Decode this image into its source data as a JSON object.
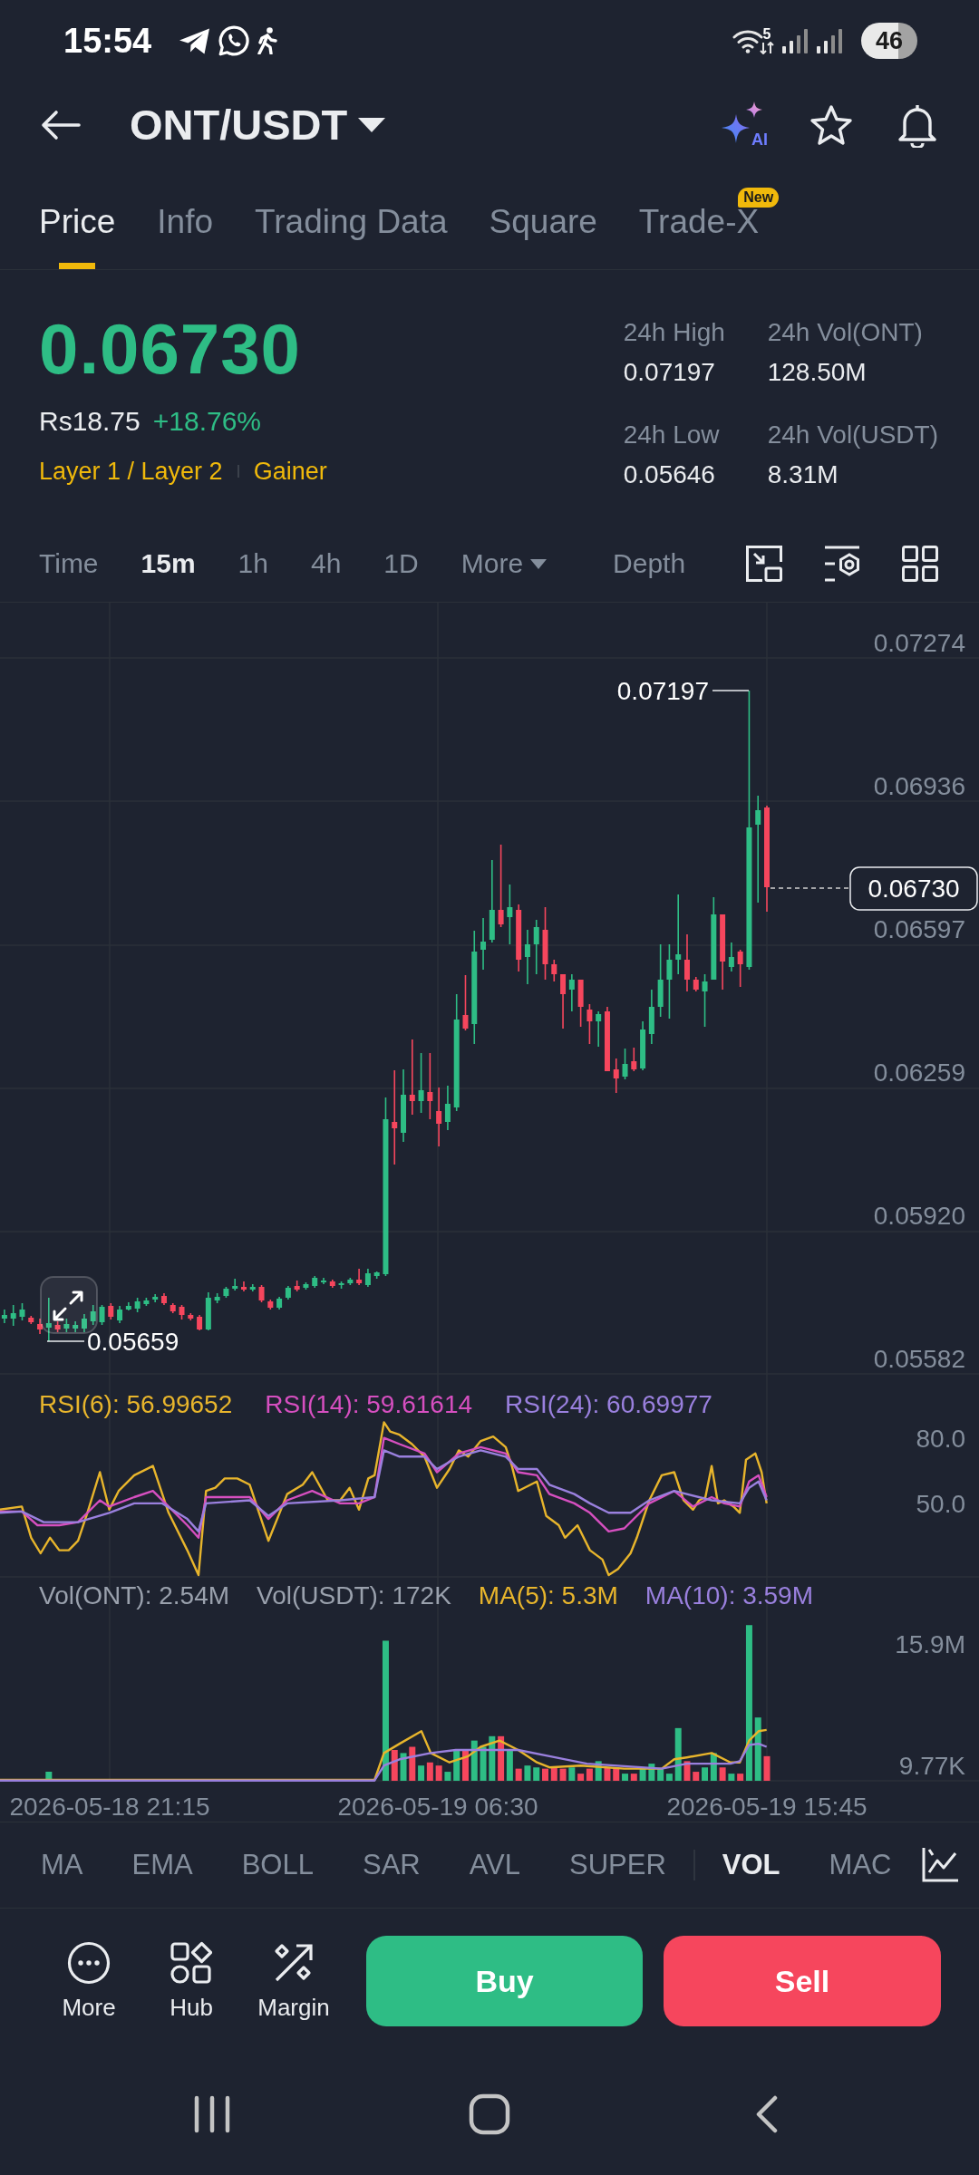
{
  "status_bar": {
    "time": "15:54",
    "network_type": "5",
    "battery": "46"
  },
  "header": {
    "title": "ONT/USDT",
    "ai_label": "AI"
  },
  "tabs": [
    {
      "label": "Price",
      "selected": true
    },
    {
      "label": "Info",
      "selected": false
    },
    {
      "label": "Trading Data",
      "selected": false
    },
    {
      "label": "Square",
      "selected": false
    },
    {
      "label": "Trade-X",
      "selected": false,
      "badge": "New"
    }
  ],
  "ticker": {
    "price": "0.06730",
    "fiat_price": "Rs18.75",
    "change": "+18.76%",
    "tags": [
      "Layer 1 / Layer 2",
      "Gainer"
    ],
    "stats": [
      {
        "label": "24h High",
        "value": "0.07197"
      },
      {
        "label": "24h Vol(ONT)",
        "value": "128.50M"
      },
      {
        "label": "24h Low",
        "value": "0.05646"
      },
      {
        "label": "24h Vol(USDT)",
        "value": "8.31M"
      }
    ]
  },
  "intervals": [
    {
      "label": "Time",
      "selected": false,
      "kind": "option"
    },
    {
      "label": "15m",
      "selected": true,
      "kind": "option"
    },
    {
      "label": "1h",
      "selected": false,
      "kind": "option"
    },
    {
      "label": "4h",
      "selected": false,
      "kind": "option"
    },
    {
      "label": "1D",
      "selected": false,
      "kind": "option"
    },
    {
      "label": "More",
      "selected": false,
      "kind": "menu"
    },
    {
      "label": "Depth",
      "selected": false,
      "kind": "view"
    }
  ],
  "chart": {
    "price_axis": [
      "0.07274",
      "0.06936",
      "0.06597",
      "0.06259",
      "0.05920",
      "0.05582"
    ],
    "high_label": "0.07197",
    "low_label": "0.05659",
    "last_price": "0.06730",
    "rsi": {
      "legend": [
        {
          "label": "RSI(6): 56.99652",
          "color": "#e8b52c"
        },
        {
          "label": "RSI(14): 59.61614",
          "color": "#d64fc0"
        },
        {
          "label": "RSI(24): 60.69977",
          "color": "#9a80de"
        }
      ],
      "axis": [
        "80.0",
        "50.0"
      ]
    },
    "volume": {
      "legend": [
        {
          "label": "Vol(ONT): 2.54M",
          "color": "#9aa1ad"
        },
        {
          "label": "Vol(USDT): 172K",
          "color": "#9aa1ad"
        },
        {
          "label": "MA(5): 5.3M",
          "color": "#e8b52c"
        },
        {
          "label": "MA(10): 3.59M",
          "color": "#9a80de"
        }
      ],
      "axis": [
        "15.9M",
        "9.77K"
      ]
    },
    "time_axis": [
      "2026-05-18 21:15",
      "2026-05-19 06:30",
      "2026-05-19 15:45"
    ]
  },
  "indicators": [
    {
      "label": "MA",
      "selected": false,
      "kind": "main"
    },
    {
      "label": "EMA",
      "selected": false,
      "kind": "main"
    },
    {
      "label": "BOLL",
      "selected": false,
      "kind": "main"
    },
    {
      "label": "SAR",
      "selected": false,
      "kind": "main"
    },
    {
      "label": "AVL",
      "selected": false,
      "kind": "main"
    },
    {
      "label": "SUPER",
      "selected": false,
      "kind": "main"
    },
    {
      "label": "VOL",
      "selected": true,
      "kind": "sub"
    },
    {
      "label": "MAC",
      "selected": false,
      "kind": "sub"
    }
  ],
  "actions": [
    {
      "label": "More",
      "kind": "more"
    },
    {
      "label": "Hub",
      "kind": "hub"
    },
    {
      "label": "Margin",
      "kind": "margin"
    }
  ],
  "trade_buttons": [
    {
      "label": "Buy",
      "kind": "buy"
    },
    {
      "label": "Sell",
      "kind": "sell"
    }
  ]
}
